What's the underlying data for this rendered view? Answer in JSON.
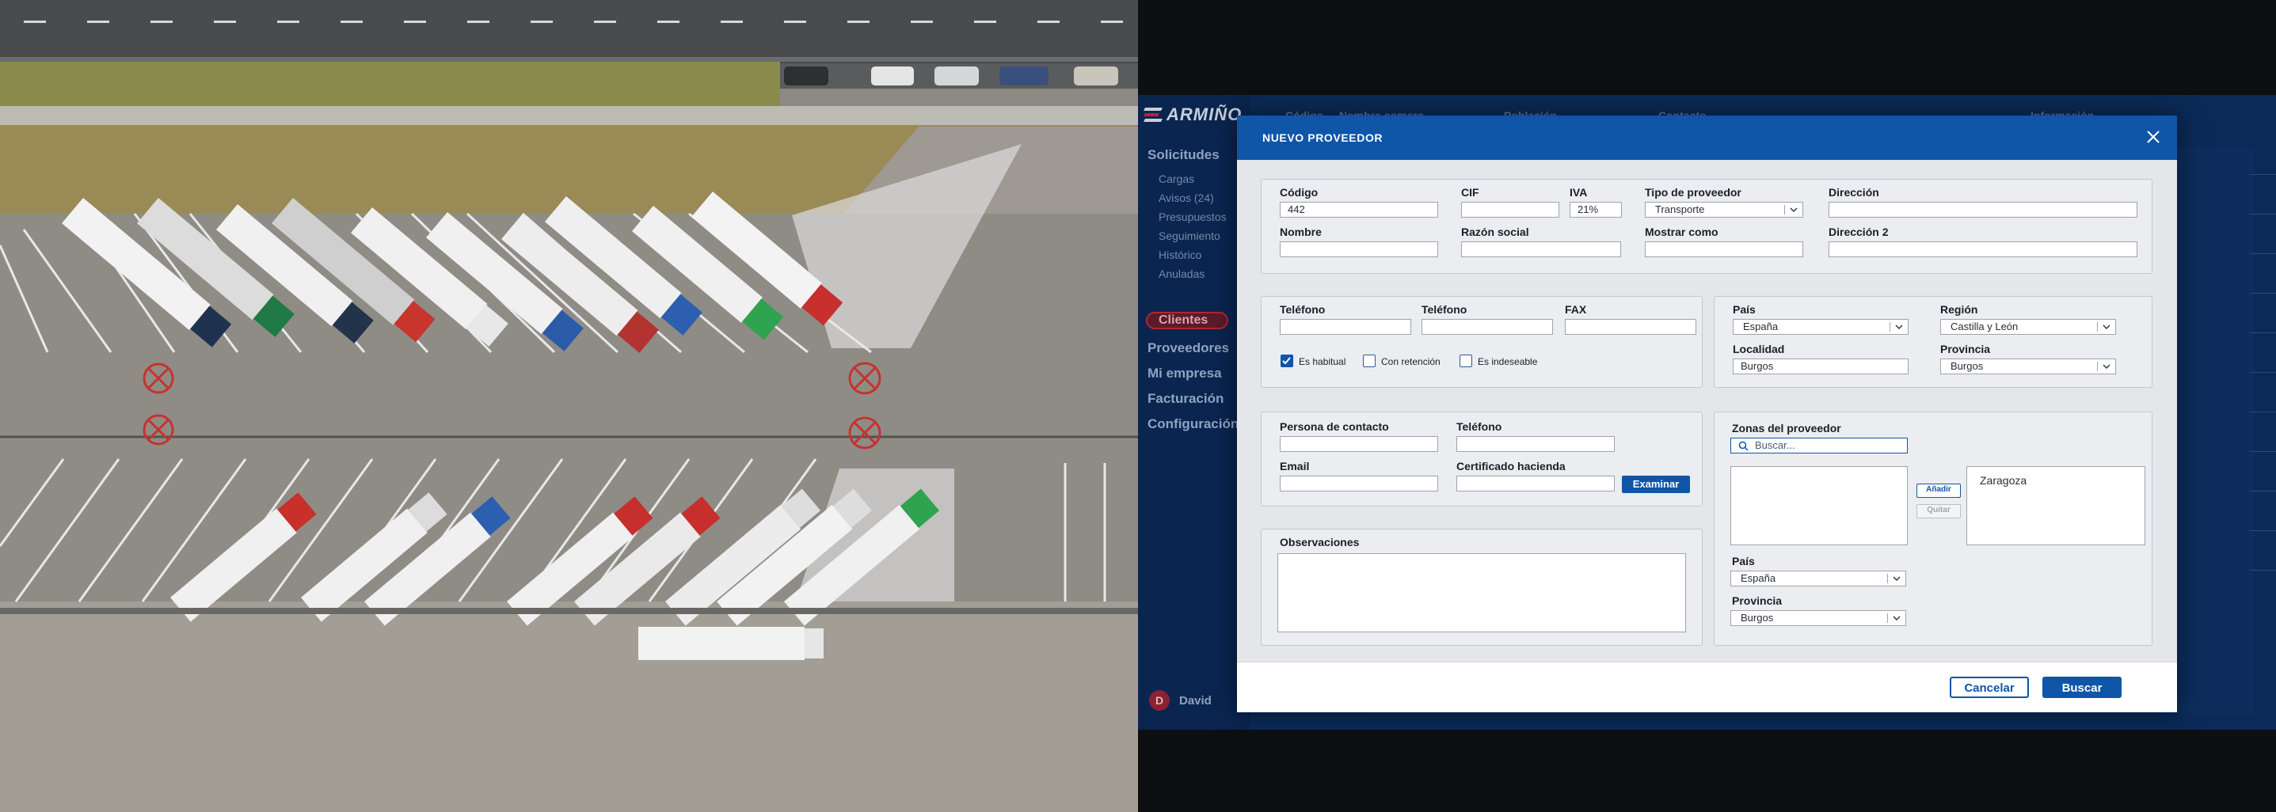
{
  "app": {
    "brand": "ARMIÑO",
    "sidebar": {
      "sections": [
        "Solicitudes",
        "Proveedores",
        "Mi empresa",
        "Facturación",
        "Configuración"
      ],
      "solicitudes_items": [
        "Cargas",
        "Avisos (24)",
        "Presupuestos",
        "Seguimiento",
        "Histórico",
        "Anuladas"
      ],
      "active": "Clientes",
      "user": "David",
      "user_initial": "D"
    },
    "background_table_headers": [
      "Código",
      "Nombre comerc.",
      "Población",
      "Contacto",
      "Información"
    ]
  },
  "modal": {
    "title": "NUEVO PROVEEDOR",
    "general": {
      "codigo_label": "Código",
      "codigo_value": "442",
      "cif_label": "CIF",
      "cif_value": "",
      "iva_label": "IVA",
      "iva_value": "21%",
      "tipo_label": "Tipo de proveedor",
      "tipo_value": "Transporte",
      "direccion_label": "Dirección",
      "direccion_value": "",
      "nombre_label": "Nombre",
      "nombre_value": "",
      "razon_label": "Razón social",
      "razon_value": "",
      "mostrar_label": "Mostrar como",
      "mostrar_value": "",
      "direccion2_label": "Dirección 2",
      "direccion2_value": ""
    },
    "phones": {
      "telefono1_label": "Teléfono",
      "telefono2_label": "Teléfono",
      "fax_label": "FAX",
      "checks": [
        {
          "label": "Es habitual",
          "checked": true
        },
        {
          "label": "Con retención",
          "checked": false
        },
        {
          "label": "Es indeseable",
          "checked": false
        }
      ]
    },
    "location": {
      "pais_label": "País",
      "pais_value": "España",
      "region_label": "Región",
      "region_value": "Castilla y León",
      "localidad_label": "Localidad",
      "localidad_value": "Burgos",
      "provincia_label": "Provincia",
      "provincia_value": "Burgos"
    },
    "contact": {
      "persona_label": "Persona de contacto",
      "telefono_label": "Teléfono",
      "email_label": "Email",
      "certificado_label": "Certificado hacienda",
      "examinar_button": "Examinar"
    },
    "observaciones_label": "Observaciones",
    "zonas": {
      "title": "Zonas del proveedor",
      "search_placeholder": "Buscar...",
      "add_button": "Añadir",
      "remove_button": "Quitar",
      "selected": [
        "Zaragoza"
      ],
      "pais_label": "País",
      "pais_value": "España",
      "provincia_label": "Provincia",
      "provincia_value": "Burgos"
    },
    "footer": {
      "cancel": "Cancelar",
      "search": "Buscar"
    }
  },
  "colors": {
    "brand_blue": "#0f55a8",
    "app_bg": "#0b2a57",
    "active_red": "#b3262f"
  }
}
